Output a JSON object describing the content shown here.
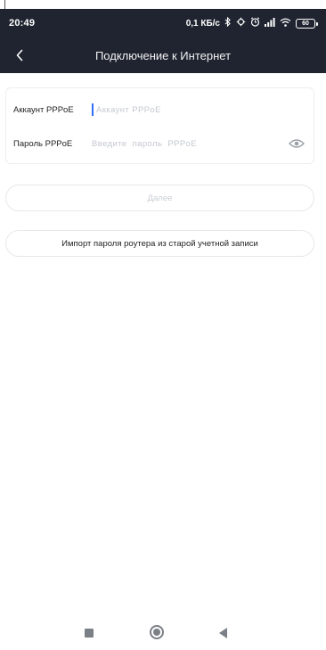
{
  "status_bar": {
    "time": "20:49",
    "speed": "0,1 КБ/с",
    "battery": "60",
    "icons": [
      "bluetooth-icon",
      "alarm-settings-icon",
      "clock-icon",
      "signal-icon",
      "wifi-icon",
      "battery-icon"
    ]
  },
  "header": {
    "title": "Подключение к Интернет",
    "back_icon": "chevron-left-icon"
  },
  "form": {
    "account": {
      "label": "Аккаунт PPPoE",
      "value": "",
      "placeholder": "Аккаунт PPPoE"
    },
    "password": {
      "label": "Пароль PPPoE",
      "value": "",
      "placeholder": "Введите  пароль  PPPoE",
      "toggle_icon": "eye-icon"
    }
  },
  "buttons": {
    "next_label": "Далее",
    "import_label": "Импорт пароля роутера из старой учетной записи"
  },
  "nav_bar": {
    "icons": [
      "recents-square-icon",
      "home-circle-icon",
      "back-triangle-icon"
    ]
  },
  "colors": {
    "header_bg": "#1f2430",
    "caret": "#2f6df6",
    "placeholder": "#c4c8d0",
    "disabled_text": "#c8ccd3"
  }
}
